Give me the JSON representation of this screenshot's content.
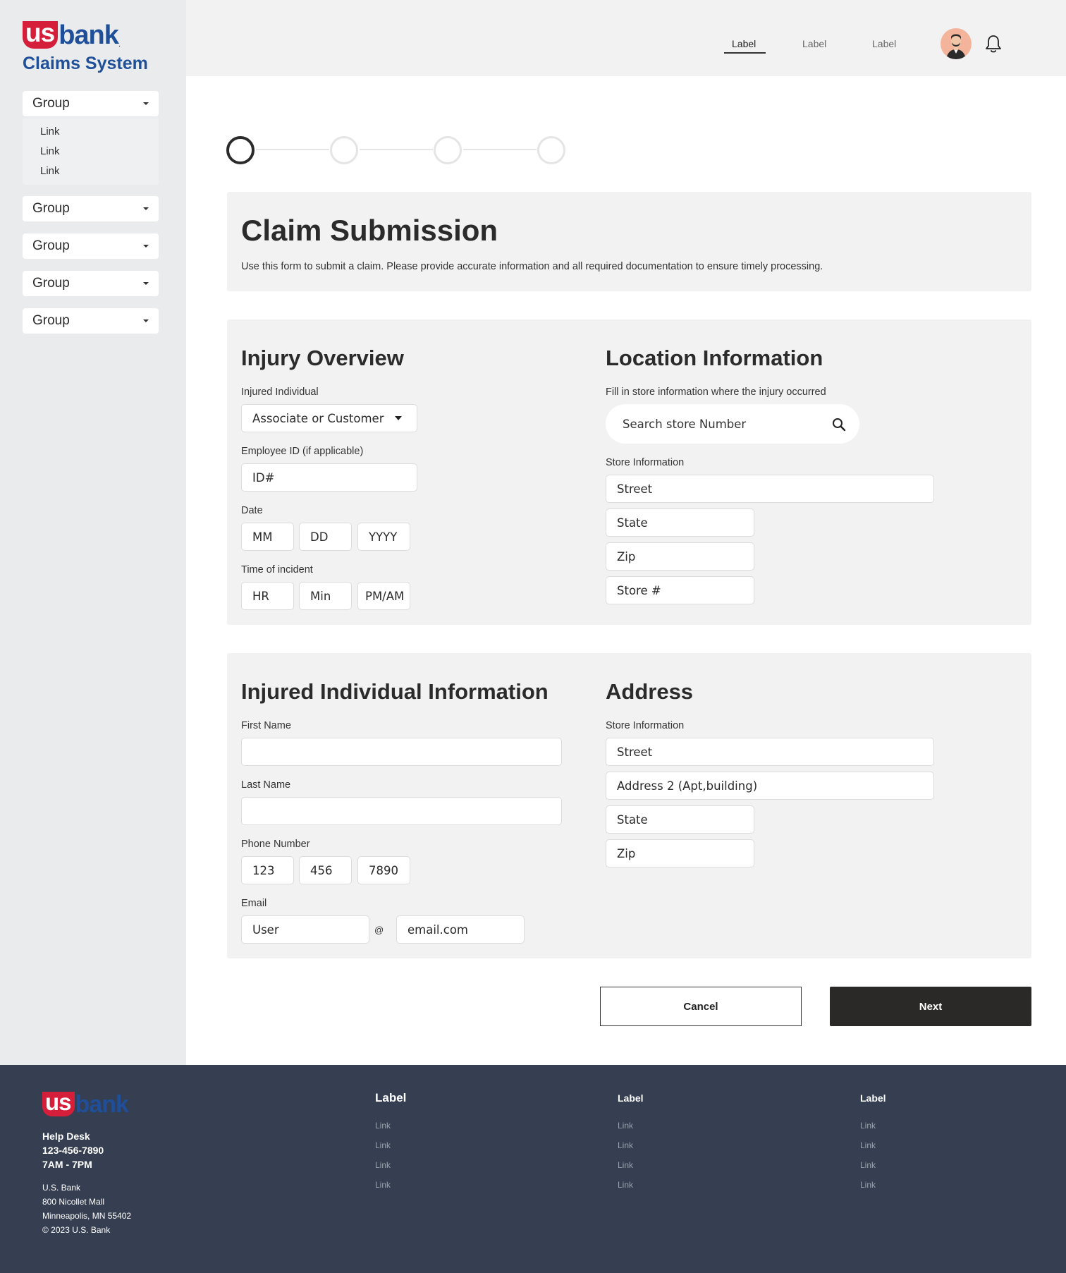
{
  "brand": {
    "logo_us": "us",
    "logo_bank": "bank",
    "app_title": "Claims System",
    "brand_red": "#d41e3a",
    "brand_blue": "#1f4f99"
  },
  "sidebar": {
    "groups": [
      {
        "label": "Group",
        "links": [
          "Link",
          "Link",
          "Link"
        ]
      },
      {
        "label": "Group"
      },
      {
        "label": "Group"
      },
      {
        "label": "Group"
      },
      {
        "label": "Group"
      }
    ]
  },
  "header": {
    "nav": [
      {
        "label": "Label",
        "active": true
      },
      {
        "label": "Label",
        "active": false
      },
      {
        "label": "Label",
        "active": false
      }
    ],
    "icons": [
      "avatar",
      "bell-icon"
    ]
  },
  "stepper": {
    "steps": 4,
    "current": 1
  },
  "intro": {
    "title": "Claim Submission",
    "description": "Use this form to submit a claim. Please provide accurate information and all required documentation to ensure timely processing."
  },
  "injury_overview": {
    "title": "Injury Overview",
    "injured_individual_label": "Injured Individual",
    "injured_individual_value": "Associate or Customer",
    "employee_id_label": "Employee ID (if applicable)",
    "employee_id_placeholder": "ID#",
    "date_label": "Date",
    "date_fields": [
      "MM",
      "DD",
      "YYYY"
    ],
    "time_label": "Time of incident",
    "time_fields": [
      "HR",
      "Min",
      "PM/AM"
    ]
  },
  "location": {
    "title": "Location Information",
    "description": "Fill in store information where the injury occurred",
    "search_placeholder": "Search store Number",
    "store_info_label": "Store Information",
    "fields": [
      "Street",
      "State",
      "Zip",
      "Store #"
    ]
  },
  "individual": {
    "title": "Injured Individual Information",
    "first_name_label": "First Name",
    "first_name_value": "",
    "last_name_label": "Last Name",
    "last_name_value": "",
    "phone_label": "Phone Number",
    "phone_fields": [
      "123",
      "456",
      "7890"
    ],
    "email_label": "Email",
    "email_user": "User",
    "email_at": "@",
    "email_domain": "email.com"
  },
  "address": {
    "title": "Address",
    "store_info_label": "Store Information",
    "fields": [
      "Street",
      "Address 2 (Apt,building)",
      "State",
      "Zip"
    ]
  },
  "actions": {
    "cancel": "Cancel",
    "next": "Next"
  },
  "footer": {
    "help_title": "Help Desk",
    "help_phone": "123-456-7890",
    "help_hours": "7AM - 7PM",
    "address_lines": [
      "U.S. Bank",
      "800 Nicollet Mall",
      "Minneapolis, MN 55402",
      "© 2023 U.S. Bank"
    ],
    "columns": [
      {
        "title": "Label",
        "links": [
          "Link",
          "Link",
          "Link",
          "Link"
        ]
      },
      {
        "title": "Label",
        "links": [
          "Link",
          "Link",
          "Link",
          "Link"
        ]
      },
      {
        "title": "Label",
        "links": [
          "Link",
          "Link",
          "Link",
          "Link"
        ]
      }
    ]
  }
}
